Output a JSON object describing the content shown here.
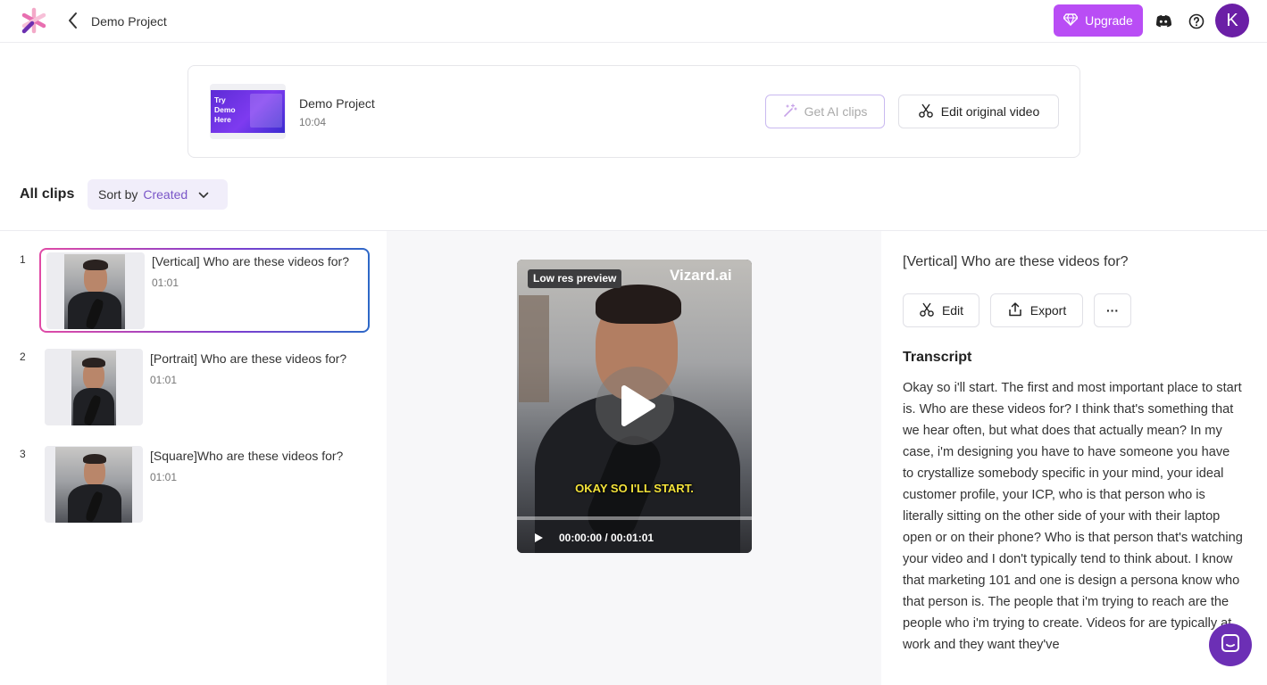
{
  "header": {
    "project_title": "Demo Project",
    "upgrade_label": "Upgrade",
    "avatar_initial": "K",
    "colors": {
      "accent": "#b94df5",
      "avatar": "#6b1fa6"
    }
  },
  "project_card": {
    "thumb_text": "Try Demo Here",
    "name": "Demo Project",
    "duration": "10:04",
    "get_ai_clips_label": "Get AI clips",
    "edit_original_label": "Edit original video"
  },
  "clips_header": {
    "title": "All clips",
    "sort_label": "Sort by",
    "sort_value": "Created"
  },
  "clips": [
    {
      "index": "1",
      "title": "[Vertical] Who are these videos for?",
      "duration": "01:01",
      "selected": true
    },
    {
      "index": "2",
      "title": "[Portrait] Who are these videos for?",
      "duration": "01:01",
      "selected": false
    },
    {
      "index": "3",
      "title": "[Square]Who are these videos for?",
      "duration": "01:01",
      "selected": false
    }
  ],
  "player": {
    "badge": "Low res preview",
    "watermark": "Vizard.ai",
    "caption": "OKAY SO I'LL START.",
    "time": "00:00:00 / 00:01:01"
  },
  "detail": {
    "title": "[Vertical] Who are these videos for?",
    "edit_label": "Edit",
    "export_label": "Export",
    "more_label": "···",
    "transcript_heading": "Transcript",
    "transcript_text": "Okay so i'll start. The first and most important place to start is. Who are these videos for? I think that's something that we hear often, but what does that actually mean? In my case, i'm designing you have to have someone you have to crystallize somebody specific in your mind, your ideal customer profile, your ICP, who is that person who is literally sitting on the other side of your with their laptop open or on their phone? Who is that person that's watching your video and I don't typically tend to think about. I know that marketing 101 and one is design a persona know who that person is. The people that i'm trying to reach are the people who i'm trying to create. Videos for are typically at work and they want they've"
  }
}
